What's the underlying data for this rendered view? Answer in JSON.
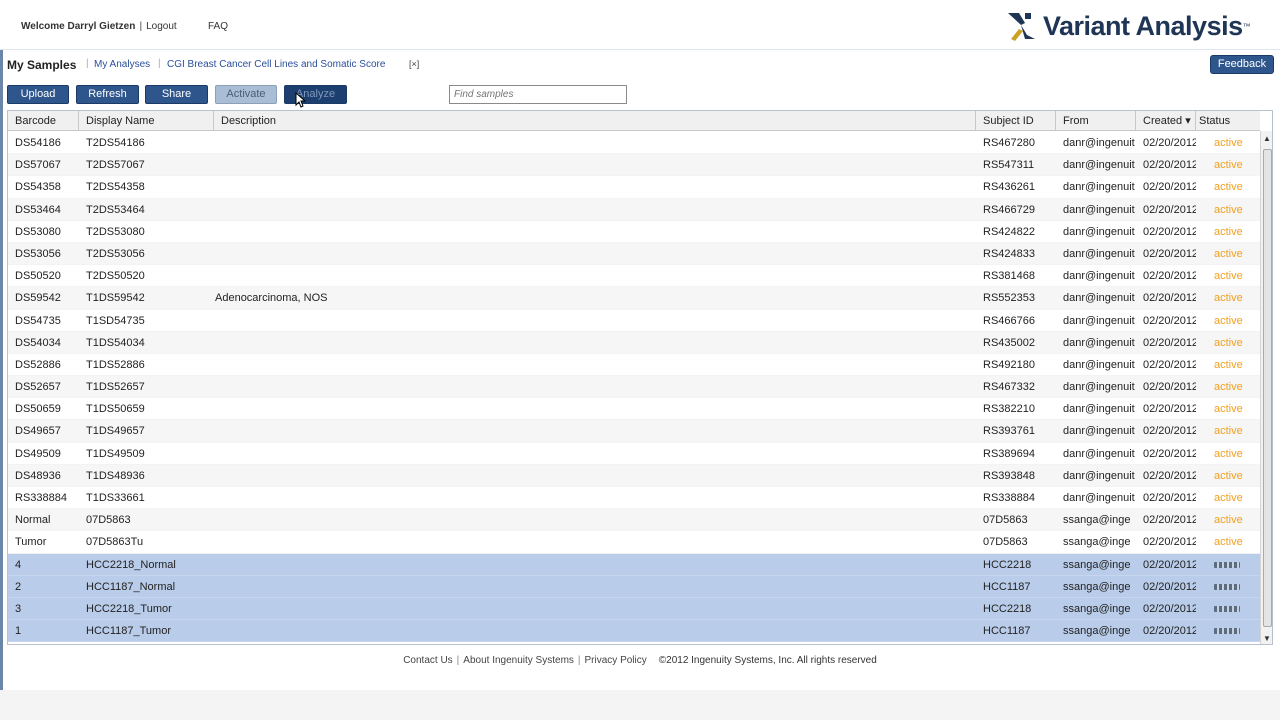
{
  "header": {
    "welcome": "Welcome Darryl Gietzen",
    "logout": "Logout",
    "faq": "FAQ",
    "logo_text": "Variant Analysis",
    "logo_tm": "™"
  },
  "nav": {
    "title": "My Samples",
    "links": [
      "My Analyses",
      "CGI Breast Cancer Cell Lines and Somatic Score"
    ],
    "close_label": "[×]",
    "feedback": "Feedback"
  },
  "toolbar": {
    "upload": "Upload",
    "refresh": "Refresh",
    "share": "Share",
    "activate": "Activate",
    "analyze": "Analyze",
    "search_placeholder": "Find samples"
  },
  "table": {
    "columns": [
      "Barcode",
      "Display Name",
      "Description",
      "Subject ID",
      "From",
      "Created ▾",
      "Status"
    ],
    "rows": [
      {
        "barcode": "DS54186",
        "name": "T2DS54186",
        "desc": "",
        "subject": "RS467280",
        "from": "danr@ingenuit",
        "created": "02/20/2012",
        "status": "active"
      },
      {
        "barcode": "DS57067",
        "name": "T2DS57067",
        "desc": "",
        "subject": "RS547311",
        "from": "danr@ingenuit",
        "created": "02/20/2012",
        "status": "active"
      },
      {
        "barcode": "DS54358",
        "name": "T2DS54358",
        "desc": "",
        "subject": "RS436261",
        "from": "danr@ingenuit",
        "created": "02/20/2012",
        "status": "active"
      },
      {
        "barcode": "DS53464",
        "name": "T2DS53464",
        "desc": "",
        "subject": "RS466729",
        "from": "danr@ingenuit",
        "created": "02/20/2012",
        "status": "active"
      },
      {
        "barcode": "DS53080",
        "name": "T2DS53080",
        "desc": "",
        "subject": "RS424822",
        "from": "danr@ingenuit",
        "created": "02/20/2012",
        "status": "active"
      },
      {
        "barcode": "DS53056",
        "name": "T2DS53056",
        "desc": "",
        "subject": "RS424833",
        "from": "danr@ingenuit",
        "created": "02/20/2012",
        "status": "active"
      },
      {
        "barcode": "DS50520",
        "name": "T2DS50520",
        "desc": "",
        "subject": "RS381468",
        "from": "danr@ingenuit",
        "created": "02/20/2012",
        "status": "active"
      },
      {
        "barcode": "DS59542",
        "name": "T1DS59542",
        "desc": "Adenocarcinoma, NOS",
        "subject": "RS552353",
        "from": "danr@ingenuit",
        "created": "02/20/2012",
        "status": "active"
      },
      {
        "barcode": "DS54735",
        "name": "T1SD54735",
        "desc": "",
        "subject": "RS466766",
        "from": "danr@ingenuit",
        "created": "02/20/2012",
        "status": "active"
      },
      {
        "barcode": "DS54034",
        "name": "T1DS54034",
        "desc": "",
        "subject": "RS435002",
        "from": "danr@ingenuit",
        "created": "02/20/2012",
        "status": "active"
      },
      {
        "barcode": "DS52886",
        "name": "T1DS52886",
        "desc": "",
        "subject": "RS492180",
        "from": "danr@ingenuit",
        "created": "02/20/2012",
        "status": "active"
      },
      {
        "barcode": "DS52657",
        "name": "T1DS52657",
        "desc": "",
        "subject": "RS467332",
        "from": "danr@ingenuit",
        "created": "02/20/2012",
        "status": "active"
      },
      {
        "barcode": "DS50659",
        "name": "T1DS50659",
        "desc": "",
        "subject": "RS382210",
        "from": "danr@ingenuit",
        "created": "02/20/2012",
        "status": "active"
      },
      {
        "barcode": "DS49657",
        "name": "T1DS49657",
        "desc": "",
        "subject": "RS393761",
        "from": "danr@ingenuit",
        "created": "02/20/2012",
        "status": "active"
      },
      {
        "barcode": "DS49509",
        "name": "T1DS49509",
        "desc": "",
        "subject": "RS389694",
        "from": "danr@ingenuit",
        "created": "02/20/2012",
        "status": "active"
      },
      {
        "barcode": "DS48936",
        "name": "T1DS48936",
        "desc": "",
        "subject": "RS393848",
        "from": "danr@ingenuit",
        "created": "02/20/2012",
        "status": "active"
      },
      {
        "barcode": "RS338884",
        "name": "T1DS33661",
        "desc": "",
        "subject": "RS338884",
        "from": "danr@ingenuit",
        "created": "02/20/2012",
        "status": "active"
      },
      {
        "barcode": "Normal",
        "name": "07D5863",
        "desc": "",
        "subject": "07D5863",
        "from": "ssanga@inge",
        "created": "02/20/2012",
        "status": "active"
      },
      {
        "barcode": "Tumor",
        "name": "07D5863Tu",
        "desc": "",
        "subject": "07D5863",
        "from": "ssanga@inge",
        "created": "02/20/2012",
        "status": "active"
      },
      {
        "barcode": "4",
        "name": "HCC2218_Normal",
        "desc": "",
        "subject": "HCC2218",
        "from": "ssanga@inge",
        "created": "02/20/2012",
        "status": ""
      },
      {
        "barcode": "2",
        "name": "HCC1187_Normal",
        "desc": "",
        "subject": "HCC1187",
        "from": "ssanga@inge",
        "created": "02/20/2012",
        "status": ""
      },
      {
        "barcode": "3",
        "name": "HCC2218_Tumor",
        "desc": "",
        "subject": "HCC2218",
        "from": "ssanga@inge",
        "created": "02/20/2012",
        "status": ""
      },
      {
        "barcode": "1",
        "name": "HCC1187_Tumor",
        "desc": "",
        "subject": "HCC1187",
        "from": "ssanga@inge",
        "created": "02/20/2012",
        "status": ""
      }
    ]
  },
  "footer": {
    "contact": "Contact Us",
    "about": "About Ingenuity Systems",
    "privacy": "Privacy Policy",
    "copyright": "©2012 Ingenuity Systems, Inc. All rights reserved"
  },
  "colors": {
    "button": "#2e568c",
    "status_active": "#f0a020",
    "selected_row": "#b9cce9",
    "logo": "#1f3555"
  }
}
